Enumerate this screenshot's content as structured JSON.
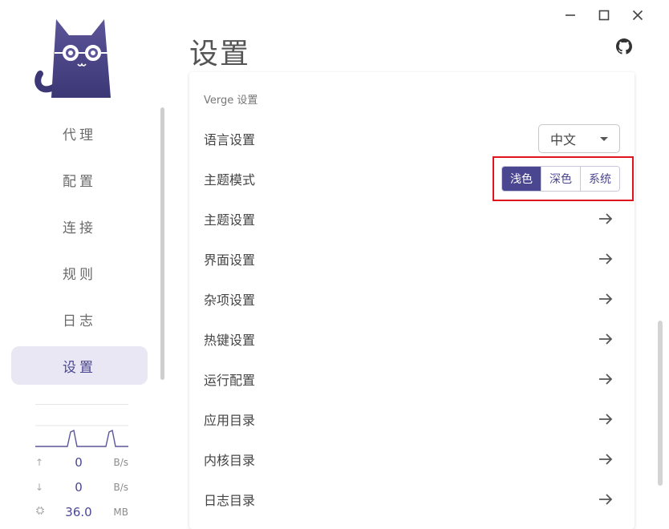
{
  "window": {
    "controls": [
      "minimize-icon",
      "maximize-icon",
      "close-icon"
    ]
  },
  "sidebar": {
    "items": [
      {
        "label": "代理"
      },
      {
        "label": "配置"
      },
      {
        "label": "连接"
      },
      {
        "label": "规则"
      },
      {
        "label": "日志"
      },
      {
        "label": "设置",
        "active": true
      }
    ]
  },
  "traffic": {
    "upload": {
      "value": "0",
      "unit": "B/s"
    },
    "download": {
      "value": "0",
      "unit": "B/s"
    },
    "memory": {
      "value": "36.0",
      "unit": "MB"
    }
  },
  "header": {
    "title": "设置"
  },
  "settings": {
    "section_title": "Verge 设置",
    "language": {
      "label": "语言设置",
      "value": "中文"
    },
    "theme_mode": {
      "label": "主题模式",
      "options": [
        "浅色",
        "深色",
        "系统"
      ],
      "selected": "浅色"
    },
    "rows": [
      {
        "label": "主题设置"
      },
      {
        "label": "界面设置"
      },
      {
        "label": "杂项设置"
      },
      {
        "label": "热键设置"
      },
      {
        "label": "运行配置"
      },
      {
        "label": "应用目录"
      },
      {
        "label": "内核目录"
      },
      {
        "label": "日志目录"
      }
    ]
  },
  "colors": {
    "accent": "#4b4690",
    "active_nav_bg": "#e8e7f3",
    "highlight_box": "#e0141e"
  }
}
